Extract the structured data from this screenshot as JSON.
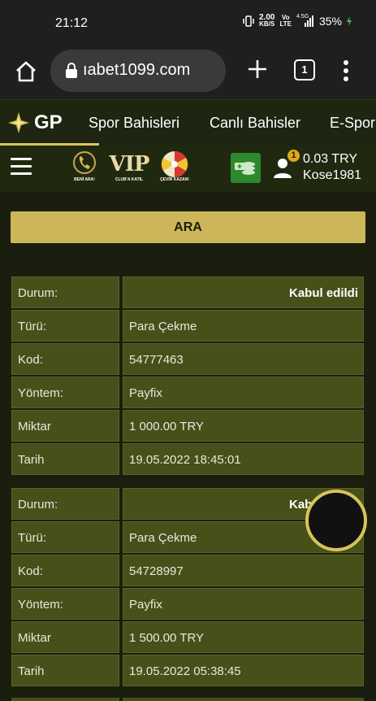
{
  "status_bar": {
    "time": "21:12",
    "net_speed_top": "2.00",
    "net_speed_unit": "KB/S",
    "volte_top": "Vo",
    "volte_bottom": "LTE",
    "signal_label": "4.5G",
    "battery": "35%"
  },
  "browser": {
    "url": "ıabet1099.com",
    "tab_count": "1"
  },
  "site_nav": {
    "logo_text": "GP",
    "links": [
      "Spor Bahisleri",
      "Canlı Bahisler",
      "E-Spor"
    ]
  },
  "header": {
    "promos": [
      "BENİ ARA!",
      "CLUB'A KATIL",
      "ÇEVİR KAZAN!"
    ],
    "vip_text": "VIP",
    "notification_count": "1",
    "balance": "0.03 TRY",
    "username": "Kose1981"
  },
  "search": {
    "button_label": "ARA"
  },
  "records": [
    {
      "rows": [
        {
          "label": "Durum:",
          "value": "Kabul edildi"
        },
        {
          "label": "Türü:",
          "value": "Para Çekme"
        },
        {
          "label": "Kod:",
          "value": "54777463"
        },
        {
          "label": "Yöntem:",
          "value": "Payfix"
        },
        {
          "label": "Miktar",
          "value": "1 000.00 TRY"
        },
        {
          "label": "Tarih",
          "value": "19.05.2022 18:45:01"
        }
      ]
    },
    {
      "rows": [
        {
          "label": "Durum:",
          "value": "Kabul edildi"
        },
        {
          "label": "Türü:",
          "value": "Para Çekme"
        },
        {
          "label": "Kod:",
          "value": "54728997"
        },
        {
          "label": "Yöntem:",
          "value": "Payfix"
        },
        {
          "label": "Miktar",
          "value": "1 500.00 TRY"
        },
        {
          "label": "Tarih",
          "value": "19.05.2022 05:38:45"
        }
      ]
    }
  ],
  "colors": {
    "accent": "#cdb65a",
    "cell_bg": "#48501a",
    "page_bg": "#1a1e0e",
    "cash_button": "#2c8a2c"
  }
}
